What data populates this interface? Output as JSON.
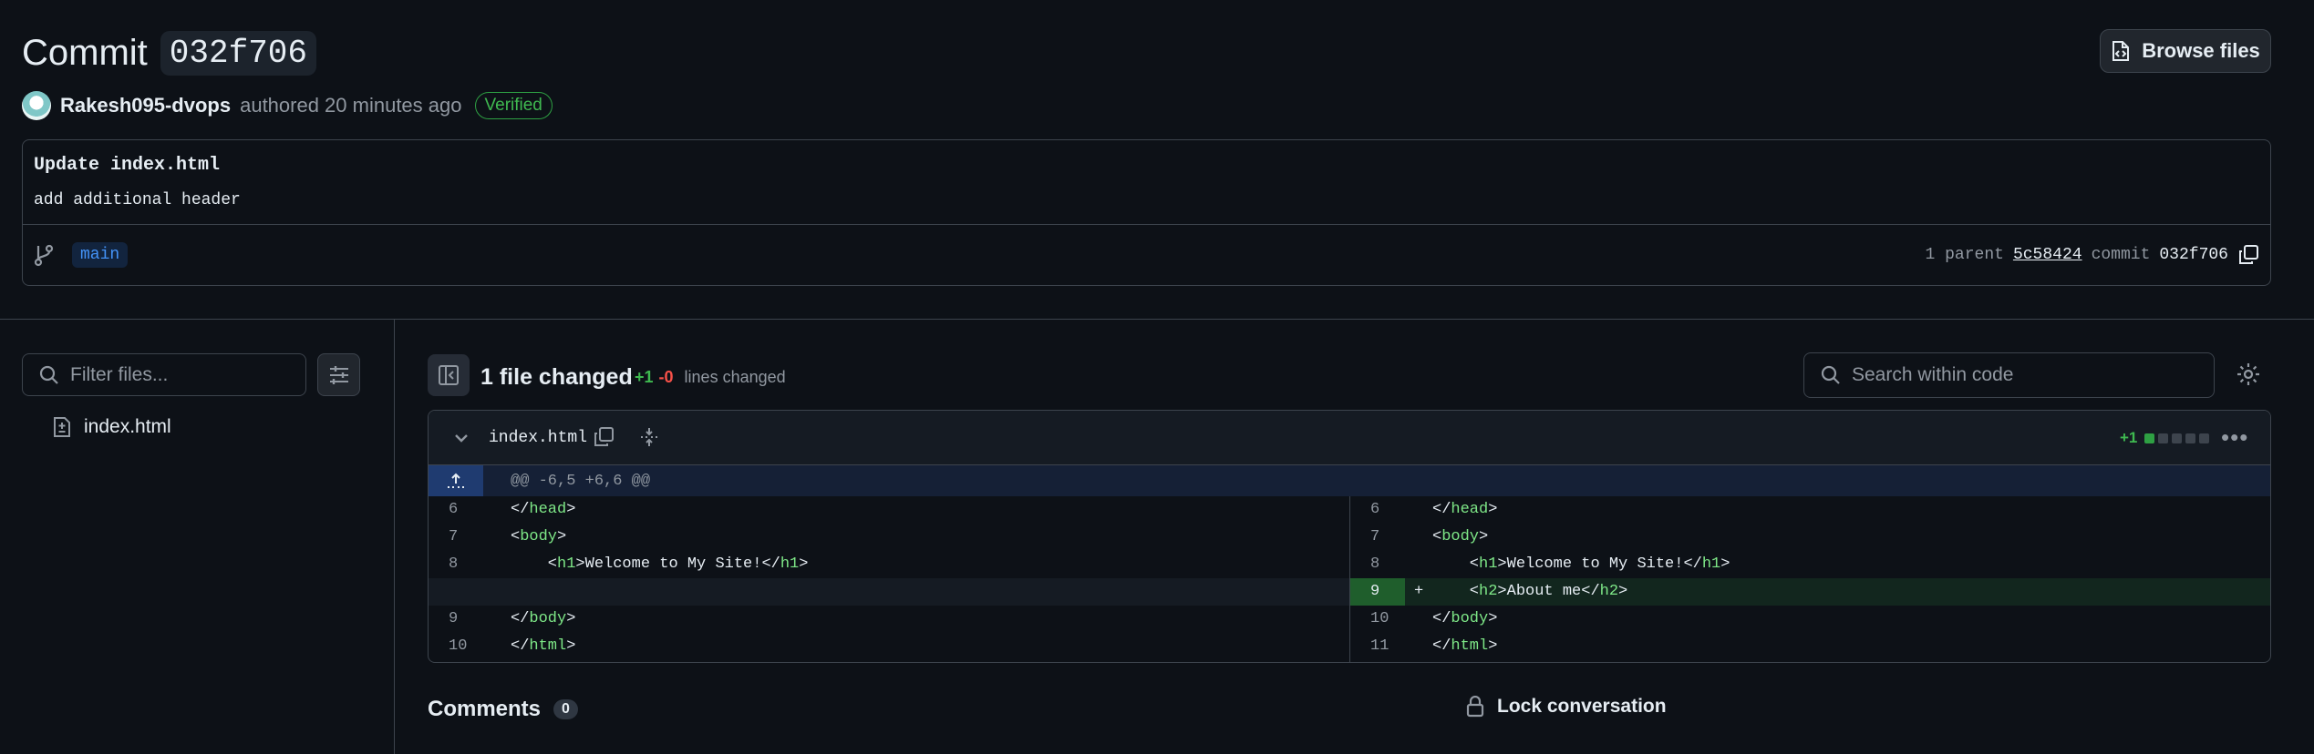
{
  "commit": {
    "title_prefix": "Commit",
    "sha": "032f706",
    "browse_label": "Browse files",
    "author": "Rakesh095-dvops",
    "authored_text": "authored 20 minutes ago",
    "verified_label": "Verified",
    "message_title": "Update index.html",
    "message_body": "add additional header",
    "branch": "main",
    "parent_count_text": "1 parent",
    "parent_sha": "5c58424",
    "commit_label": "commit",
    "commit_sha": "032f706"
  },
  "sidebar": {
    "filter_placeholder": "Filter files...",
    "files": [
      {
        "name": "index.html"
      }
    ]
  },
  "summary": {
    "files_changed": "1 file changed",
    "additions": "+1",
    "deletions": "-0",
    "lines_changed_label": "lines changed",
    "search_placeholder": "Search within code"
  },
  "diff": {
    "file_name": "index.html",
    "stat": "+1",
    "stat_blocks": {
      "added": 1,
      "deleted": 0,
      "total": 5
    },
    "hunk_header": "@@ -6,5 +6,6 @@",
    "left": [
      {
        "num": "6",
        "pre": "</",
        "tag": "head",
        "post": ">"
      },
      {
        "num": "7",
        "pre": "<",
        "tag": "body",
        "post": ">"
      },
      {
        "num": "8",
        "pre": "    <",
        "tag": "h1",
        "post": ">Welcome to My Site!</",
        "tag2": "h1",
        "post2": ">"
      },
      {
        "num": "",
        "pre": "",
        "tag": "",
        "post": ""
      },
      {
        "num": "9",
        "pre": "</",
        "tag": "body",
        "post": ">"
      },
      {
        "num": "10",
        "pre": "</",
        "tag": "html",
        "post": ">"
      }
    ],
    "right": [
      {
        "num": "6",
        "pre": "</",
        "tag": "head",
        "post": ">"
      },
      {
        "num": "7",
        "pre": "<",
        "tag": "body",
        "post": ">"
      },
      {
        "num": "8",
        "pre": "    <",
        "tag": "h1",
        "post": ">Welcome to My Site!</",
        "tag2": "h1",
        "post2": ">"
      },
      {
        "num": "9",
        "sign": "+",
        "pre": "    <",
        "tag": "h2",
        "post": ">About me</",
        "tag2": "h2",
        "post2": ">"
      },
      {
        "num": "10",
        "pre": "</",
        "tag": "body",
        "post": ">"
      },
      {
        "num": "11",
        "pre": "</",
        "tag": "html",
        "post": ">"
      }
    ]
  },
  "comments": {
    "label": "Comments",
    "count": "0",
    "lock_label": "Lock conversation"
  },
  "colors": {
    "background": "#0d1117",
    "accent_green": "#3fb950",
    "accent_red": "#f85149",
    "link_blue": "#4493f8"
  }
}
